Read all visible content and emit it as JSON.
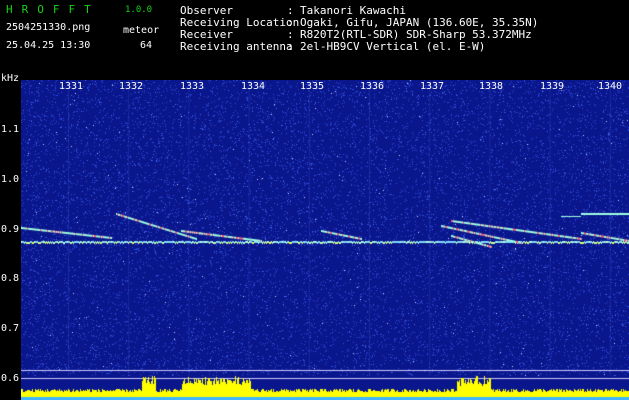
{
  "app": {
    "title": "HROFFT",
    "version": "1.0.0"
  },
  "file": {
    "name": "2504251330.png",
    "timestamp": "25.04.25 13:30"
  },
  "counter": {
    "label": "meteor",
    "value": "64"
  },
  "info": [
    {
      "label": "Observer",
      "sep": ":",
      "value": "Takanori Kawachi"
    },
    {
      "label": "Receiving Location",
      "sep": ":",
      "value": "Ogaki, Gifu, JAPAN (136.60E, 35.35N)"
    },
    {
      "label": "Receiver",
      "sep": ":",
      "value": "R820T2(RTL-SDR) SDR-Sharp 53.372MHz"
    },
    {
      "label": "Receiving antenna",
      "sep": ":",
      "value": "2el-HB9CV Vertical (el. E-W)"
    }
  ],
  "y_axis": {
    "unit": "kHz",
    "ticks": [
      "1.1",
      "1.0",
      "0.9",
      "0.8",
      "0.7",
      "0.6"
    ]
  },
  "x_axis": {
    "ticks": [
      "1331",
      "1332",
      "1333",
      "1334",
      "1335",
      "1336",
      "1337",
      "1338",
      "1339",
      "1340"
    ]
  },
  "colors": {
    "background": "#0a168c",
    "noise": "#2a4bd8",
    "carrier": "#f0ff50",
    "meteor": "#9fffe0",
    "level_bar": "#ffff00",
    "grid_line": "#c8c8ff"
  }
}
